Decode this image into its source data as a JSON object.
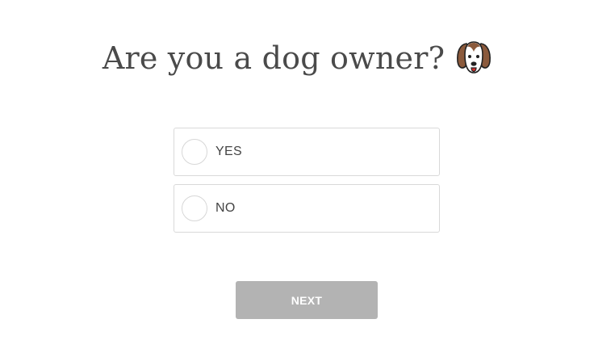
{
  "question": {
    "title": "Are you a dog owner?",
    "icon": "dog-face-icon"
  },
  "options": [
    {
      "label": "YES",
      "selected": false
    },
    {
      "label": "NO",
      "selected": false
    }
  ],
  "actions": {
    "next_label": "NEXT",
    "next_enabled": false
  },
  "colors": {
    "title_text": "#4a4a4a",
    "option_border": "#d9d9d9",
    "button_disabled_bg": "#b3b3b3",
    "dog_brown": "#8b5a3c",
    "dog_tongue": "#d62b2b"
  }
}
